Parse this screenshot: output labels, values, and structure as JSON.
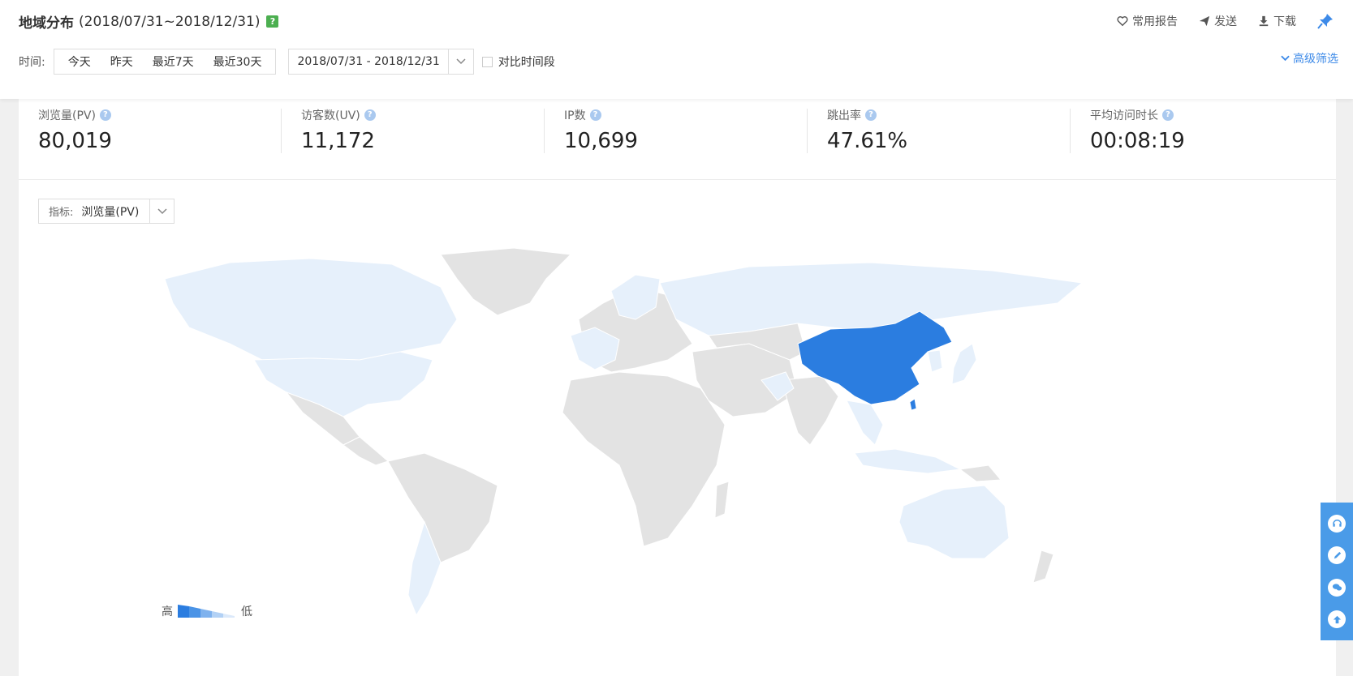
{
  "header": {
    "title": "地域分布",
    "range": "(2018/07/31~2018/12/31)",
    "help_glyph": "?",
    "actions": [
      {
        "label": "常用报告",
        "icon": "heart-icon"
      },
      {
        "label": "发送",
        "icon": "send-icon"
      },
      {
        "label": "下载",
        "icon": "download-icon"
      }
    ],
    "pin_icon": "pin-icon"
  },
  "time_filter": {
    "label": "时间:",
    "quick": [
      "今天",
      "昨天",
      "最近7天",
      "最近30天"
    ],
    "date_range": "2018/07/31 - 2018/12/31",
    "compare_label": "对比时间段",
    "advanced_label": "高级筛选"
  },
  "metrics": [
    {
      "label": "浏览量(PV)",
      "value": "80,019"
    },
    {
      "label": "访客数(UV)",
      "value": "11,172"
    },
    {
      "label": "IP数",
      "value": "10,699"
    },
    {
      "label": "跳出率",
      "value": "47.61%"
    },
    {
      "label": "平均访问时长",
      "value": "00:08:19"
    }
  ],
  "indicator": {
    "label": "指标:",
    "value": "浏览量(PV)"
  },
  "legend": {
    "high": "高",
    "low": "低"
  },
  "colors": {
    "accent": "#3d8ae8",
    "map_high": "#2b7de0",
    "map_low": "#e6f0fb",
    "map_none": "#e3e3e3",
    "float_bar": "#4a9be8"
  },
  "float_bar_icons": [
    "headset-icon",
    "edit-icon",
    "wechat-icon",
    "arrow-up-icon"
  ]
}
